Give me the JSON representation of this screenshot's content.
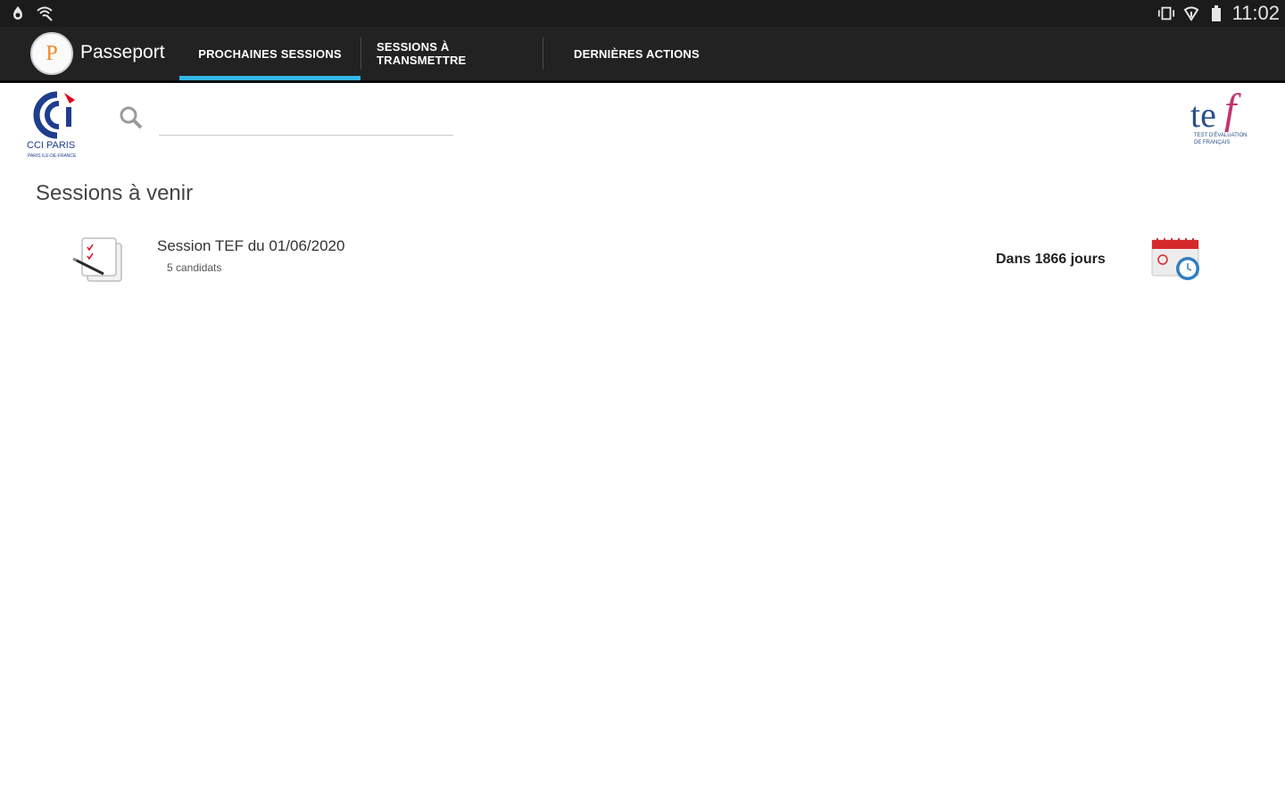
{
  "status_bar": {
    "time": "11:02",
    "left_icons": [
      "notification-icon",
      "wifi-signal-icon"
    ],
    "right_icons": [
      "vibrate-icon",
      "wifi-icon",
      "battery-icon"
    ]
  },
  "action_bar": {
    "logo_letter": "P",
    "title": "Passeport",
    "tabs": [
      {
        "line1": "PROCHAINES SESSIONS",
        "line2": "",
        "selected": true
      },
      {
        "line1": "SESSIONS À",
        "line2": "TRANSMETTRE",
        "selected": false
      },
      {
        "line1": "DERNIÈRES ACTIONS",
        "line2": "",
        "selected": false
      }
    ],
    "indicator_color": "#33b5e5"
  },
  "header": {
    "left_logo": {
      "letters": "CCi",
      "caption": "CCI PARIS",
      "subcaption": "PARIS ILE-DE-FRANCE"
    },
    "search": {
      "placeholder": "",
      "value": ""
    },
    "right_logo": {
      "letters": "tef",
      "caption1": "TEST D'ÉVALUATION",
      "caption2": "DE FRANÇAIS"
    }
  },
  "main": {
    "section_title": "Sessions à venir",
    "sessions": [
      {
        "name": "Session TEF du 01/06/2020",
        "candidates": "5 candidats",
        "days": "Dans 1866 jours"
      }
    ]
  },
  "colors": {
    "status_bar": "#1b1b1b",
    "action_bar": "#222222",
    "accent_blue": "#33b5e5",
    "cci_blue": "#1e3d8f",
    "cci_red": "#e2001a",
    "tef_blue": "#2c4f8c",
    "tef_magenta": "#c2336f"
  }
}
